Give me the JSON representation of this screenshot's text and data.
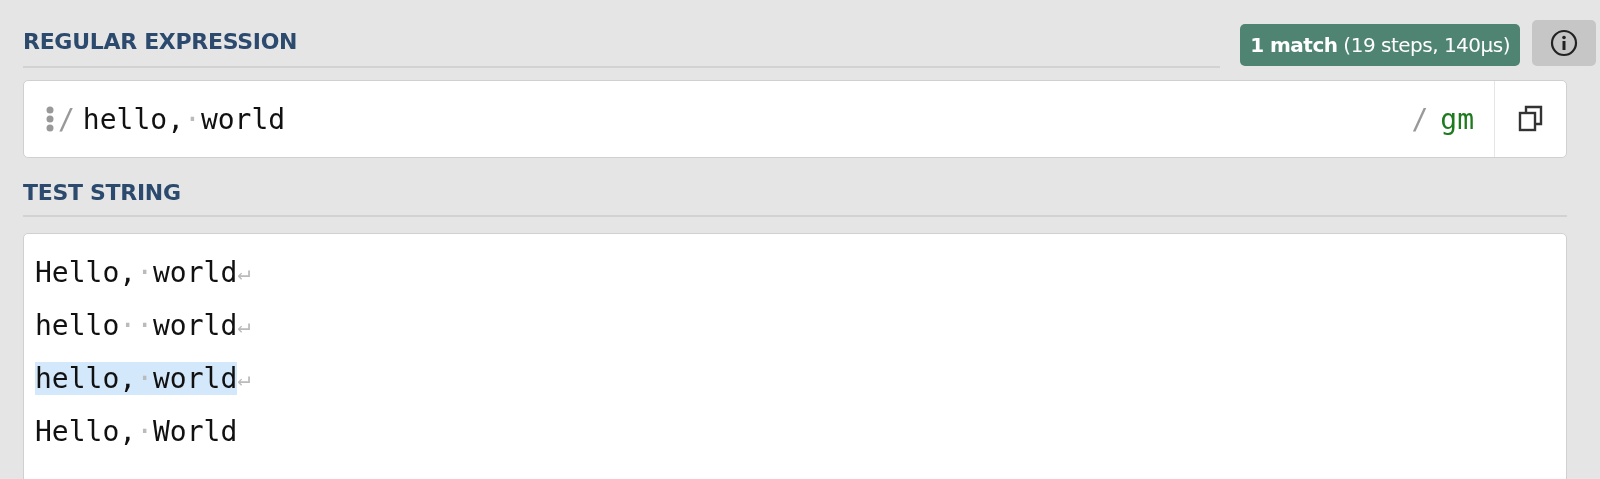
{
  "regex_section": {
    "heading": "REGULAR EXPRESSION",
    "match_badge": {
      "bold": "1 match",
      "detail": "(19 steps, 140μs)"
    },
    "expression": {
      "open_delimiter": "/",
      "segments": [
        {
          "kind": "text",
          "text": "hello,"
        },
        {
          "kind": "space",
          "text": "·"
        },
        {
          "kind": "text",
          "text": "world"
        }
      ],
      "close_delimiter": "/",
      "flags": "gm"
    }
  },
  "test_section": {
    "heading": "TEST STRING",
    "lines": [
      {
        "segments": [
          {
            "kind": "text",
            "text": "Hello,"
          },
          {
            "kind": "space",
            "text": "·"
          },
          {
            "kind": "text",
            "text": "world"
          }
        ],
        "newline": "↵",
        "matched": false
      },
      {
        "segments": [
          {
            "kind": "text",
            "text": "hello"
          },
          {
            "kind": "space",
            "text": "·"
          },
          {
            "kind": "space",
            "text": "·"
          },
          {
            "kind": "text",
            "text": "world"
          }
        ],
        "newline": "↵",
        "matched": false
      },
      {
        "segments": [
          {
            "kind": "text",
            "text": "hello,"
          },
          {
            "kind": "space",
            "text": "·"
          },
          {
            "kind": "text",
            "text": "world"
          }
        ],
        "newline": "↵",
        "matched": true
      },
      {
        "segments": [
          {
            "kind": "text",
            "text": "Hello,"
          },
          {
            "kind": "space",
            "text": "·"
          },
          {
            "kind": "text",
            "text": "World"
          }
        ],
        "matched": false
      }
    ]
  }
}
